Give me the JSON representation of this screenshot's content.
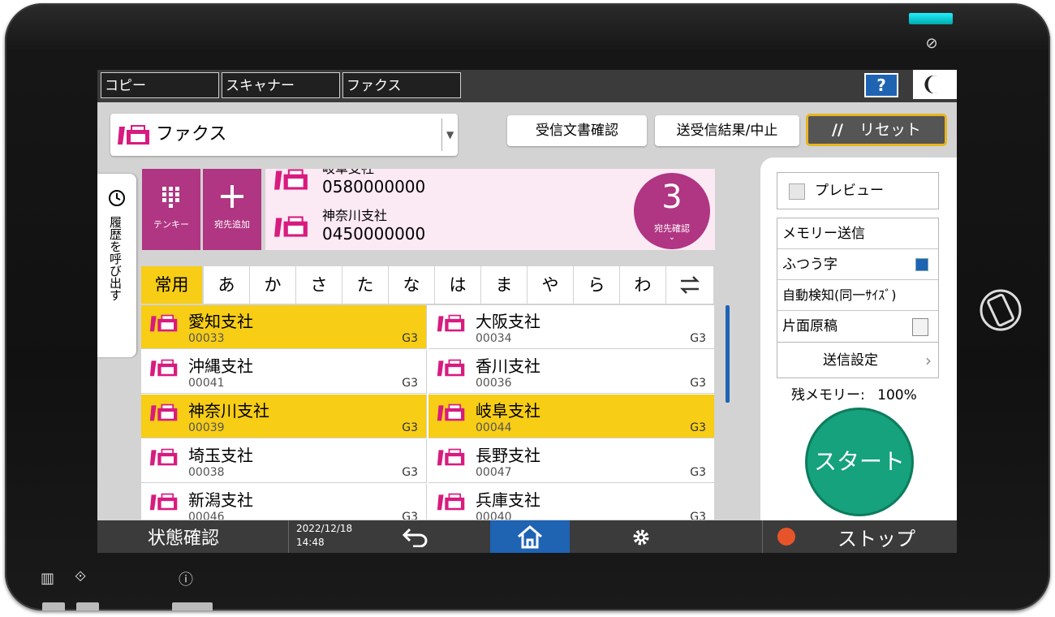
{
  "app_tabs": [
    "コピー",
    "スキャナー",
    "ファクス"
  ],
  "help_label": "?",
  "function_selector": {
    "value": "ファクス"
  },
  "buttons": {
    "received_docs": "受信文書確認",
    "tx_results": "送受信結果/中止",
    "reset": "リセット"
  },
  "tenkey": {
    "label": "テンキー"
  },
  "add_destination": {
    "label": "宛先追加"
  },
  "history_tab": {
    "label": "履歴を呼び出す"
  },
  "destinations": [
    {
      "name": "岐阜支社",
      "number": "0580000000"
    },
    {
      "name": "神奈川支社",
      "number": "0450000000"
    }
  ],
  "dest_count": {
    "count": "3",
    "label": "宛先確認"
  },
  "index_tabs": [
    "常用",
    "あ",
    "か",
    "さ",
    "た",
    "な",
    "は",
    "ま",
    "や",
    "ら",
    "わ"
  ],
  "address_book": [
    {
      "name": "愛知支社",
      "code": "00033",
      "mode": "G3",
      "selected": true
    },
    {
      "name": "大阪支社",
      "code": "00034",
      "mode": "G3",
      "selected": false
    },
    {
      "name": "沖縄支社",
      "code": "00041",
      "mode": "G3",
      "selected": false
    },
    {
      "name": "香川支社",
      "code": "00036",
      "mode": "G3",
      "selected": false
    },
    {
      "name": "神奈川支社",
      "code": "00039",
      "mode": "G3",
      "selected": true
    },
    {
      "name": "岐阜支社",
      "code": "00044",
      "mode": "G3",
      "selected": true
    },
    {
      "name": "埼玉支社",
      "code": "00038",
      "mode": "G3",
      "selected": false
    },
    {
      "name": "長野支社",
      "code": "00047",
      "mode": "G3",
      "selected": false
    },
    {
      "name": "新潟支社",
      "code": "00046",
      "mode": "G3",
      "selected": false
    },
    {
      "name": "兵庫支社",
      "code": "00040",
      "mode": "G3",
      "selected": false
    }
  ],
  "options": {
    "preview": "プレビュー",
    "memory_tx": "メモリー送信",
    "resolution": "ふつう字",
    "scan_size": "自動検知(同一ｻｲｽﾞ)",
    "duplex": "片面原稿",
    "tx_settings": "送信設定"
  },
  "memory_remaining": {
    "label": "残メモリー:",
    "value": "100%"
  },
  "start_label": "スタート",
  "bottom_bar": {
    "status": "状態確認",
    "date": "2022/12/18",
    "time": "14:48",
    "stop": "ストップ"
  },
  "colors": {
    "accent_magenta": "#b03582",
    "selected_yellow": "#f7cd16",
    "start_green": "#15a27c",
    "help_blue": "#1f63b3",
    "stop_orange": "#e8542a"
  }
}
